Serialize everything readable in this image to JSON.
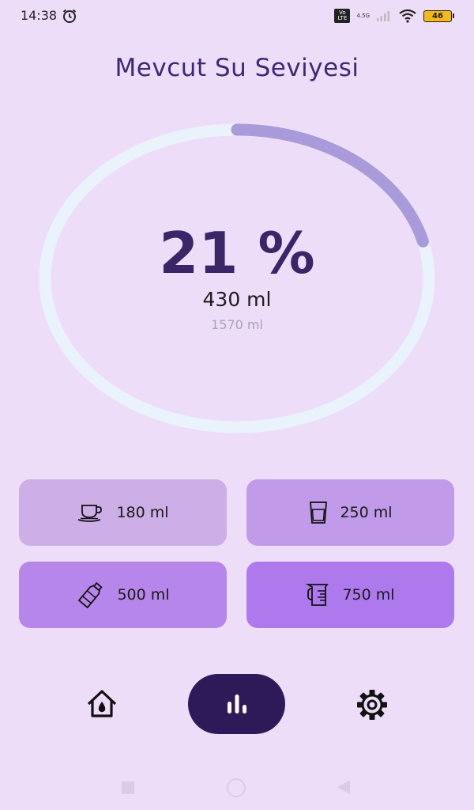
{
  "status_bar": {
    "time": "14:38",
    "volte": "Vo LTE",
    "network": "4.5G",
    "battery": "46",
    "icons": [
      "alarm-icon",
      "signal-icon",
      "wifi-icon",
      "battery-icon"
    ]
  },
  "title": "Mevcut Su Seviyesi",
  "progress": {
    "percent_text": "21 %",
    "fraction": 0.21,
    "current": "430 ml",
    "goal": "1570 ml",
    "colors": {
      "track": "#eaf2fc",
      "fill": "#a99ada"
    }
  },
  "quick_add": [
    {
      "label": "180 ml",
      "icon": "coffee-cup-icon",
      "color": "#cdaee7"
    },
    {
      "label": "250 ml",
      "icon": "glass-icon",
      "color": "#c19ae9"
    },
    {
      "label": "500 ml",
      "icon": "bottle-icon",
      "color": "#b686ea"
    },
    {
      "label": "750 ml",
      "icon": "measuring-jug-icon",
      "color": "#ad79ed"
    }
  ],
  "bottom_nav": {
    "items": [
      "home-icon",
      "stats-icon",
      "settings-icon"
    ],
    "active": "stats-icon",
    "active_color": "#2d1a58"
  }
}
